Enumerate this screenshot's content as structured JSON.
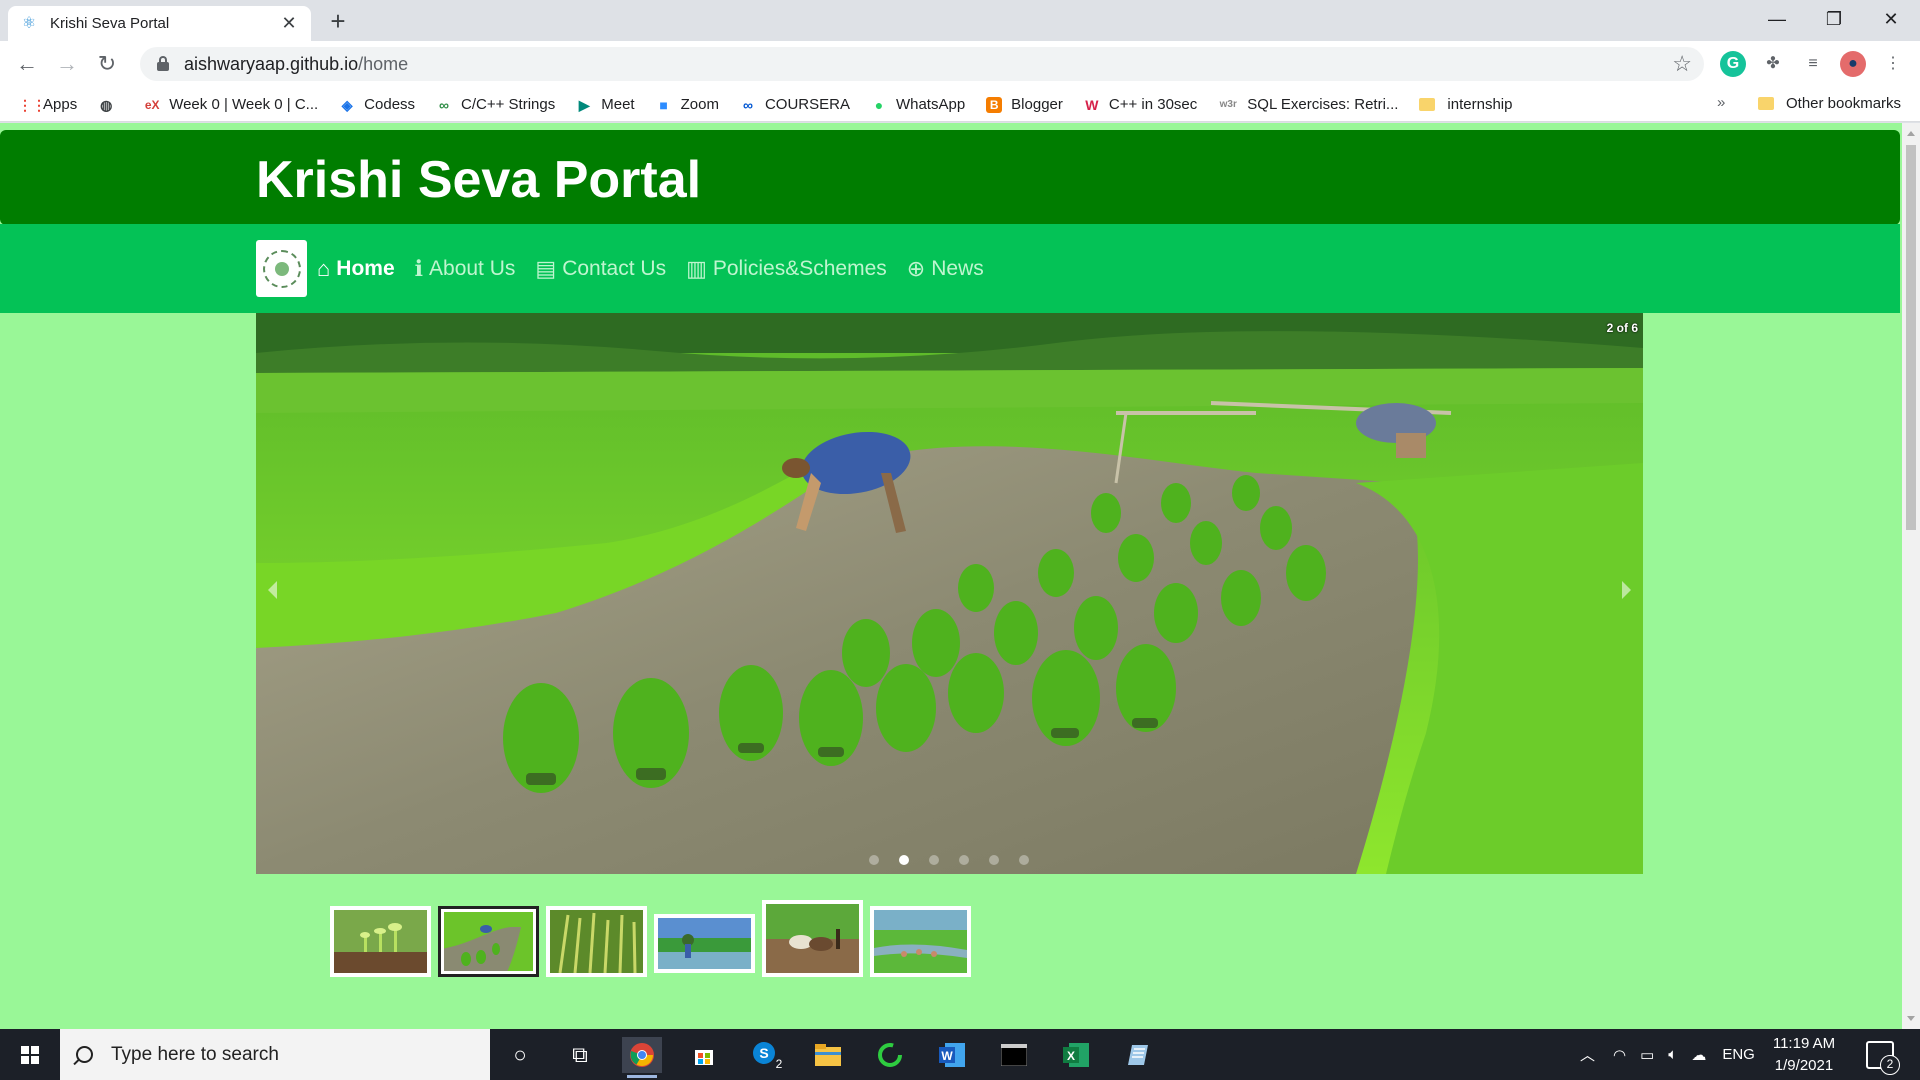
{
  "browser": {
    "tab": {
      "title": "Krishi Seva Portal",
      "favicon": "react-icon"
    },
    "new_tab_symbol": "+",
    "window_controls": {
      "minimize": "—",
      "maximize": "❐",
      "close": "✕"
    },
    "url": {
      "host": "aishwaryaap.github.io",
      "path": "/home"
    },
    "bookmarks": [
      {
        "label": "Apps",
        "icon": "apps-grid-icon",
        "color": "#ea4335",
        "glyph": "⋮⋮"
      },
      {
        "label": "",
        "icon": "globe-icon",
        "color": "#3c4043",
        "glyph": "◍"
      },
      {
        "label": "Week 0 | Week 0 | C...",
        "icon": "edx-icon",
        "color": "#d43f3a",
        "glyph": "eX"
      },
      {
        "label": "Codess",
        "icon": "codess-icon",
        "color": "#1a73e8",
        "glyph": "◈"
      },
      {
        "label": "C/C++ Strings",
        "icon": "geeksforgeeks-icon",
        "color": "#2f8d46",
        "glyph": "∞"
      },
      {
        "label": "Meet",
        "icon": "meet-icon",
        "color": "#00897b",
        "glyph": "▶"
      },
      {
        "label": "Zoom",
        "icon": "zoom-icon",
        "color": "#2d8cff",
        "glyph": "■"
      },
      {
        "label": "COURSERA",
        "icon": "coursera-icon",
        "color": "#0056d2",
        "glyph": "∞"
      },
      {
        "label": "WhatsApp",
        "icon": "whatsapp-icon",
        "color": "#25d366",
        "glyph": "●"
      },
      {
        "label": "Blogger",
        "icon": "blogger-icon",
        "color": "#f57d00",
        "glyph": "B"
      },
      {
        "label": "C++ in 30sec",
        "icon": "w-icon",
        "color": "#d6224a",
        "glyph": "W"
      },
      {
        "label": "SQL Exercises: Retri...",
        "icon": "w3resource-icon",
        "color": "#888888",
        "glyph": "w3r"
      },
      {
        "label": "internship",
        "icon": "folder-icon",
        "color": "#f9d46b",
        "glyph": ""
      }
    ],
    "bookmarks_more": "»",
    "other_bookmarks": "Other bookmarks"
  },
  "site": {
    "title": "Krishi Seva Portal",
    "colors": {
      "header": "#007d00",
      "nav": "#04c256",
      "page_bg": "#99f797"
    },
    "nav": [
      {
        "label": "Home",
        "icon": "home-icon",
        "glyph": "⌂",
        "active": true
      },
      {
        "label": "About Us",
        "icon": "info-icon",
        "glyph": "ℹ",
        "active": false
      },
      {
        "label": "Contact Us",
        "icon": "address-card-icon",
        "glyph": "▤",
        "active": false
      },
      {
        "label": "Policies&Schemes",
        "icon": "book-icon",
        "glyph": "▥",
        "active": false
      },
      {
        "label": "News",
        "icon": "search-plus-icon",
        "glyph": "⊕",
        "active": false
      }
    ],
    "carousel": {
      "counter": "2 of 6",
      "current": 2,
      "total": 6
    }
  },
  "taskbar": {
    "search_placeholder": "Type here to search",
    "skype_badge": "2",
    "language": "ENG",
    "time": "11:19 AM",
    "date": "1/9/2021",
    "notification_count": "2"
  }
}
